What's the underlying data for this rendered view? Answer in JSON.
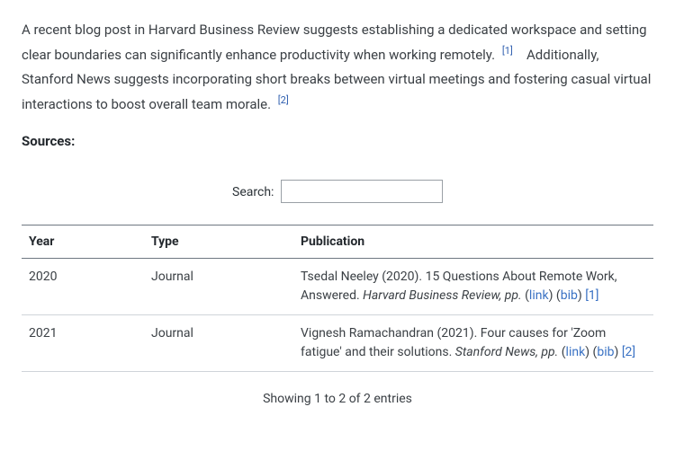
{
  "paragraph": {
    "seg1": "A recent blog post in Harvard Business Review suggests establishing a dedicated workspace and setting clear boundaries can significantly enhance productivity when working remotely.",
    "cite1": "[1]",
    "seg2": "Additionally, Stanford News suggests incorporating short breaks between virtual meetings and fostering casual virtual interactions to boost overall team morale.",
    "cite2": "[2]"
  },
  "sources_heading": "Sources:",
  "search": {
    "label": "Search:",
    "value": ""
  },
  "table": {
    "headers": {
      "year": "Year",
      "type": "Type",
      "publication": "Publication"
    },
    "rows": [
      {
        "year": "2020",
        "type": "Journal",
        "pub_prefix": "Tsedal Neeley (2020). 15 Questions About Remote Work, Answered. ",
        "pub_italic": "Harvard Business Review, pp.",
        "link_label": "link",
        "bib_label": "bib",
        "cite": "[1]"
      },
      {
        "year": "2021",
        "type": "Journal",
        "pub_prefix": "Vignesh Ramachandran (2021). Four causes for 'Zoom fatigue' and their solutions. ",
        "pub_italic": "Stanford News, pp.",
        "link_label": "link",
        "bib_label": "bib",
        "cite": "[2]"
      }
    ]
  },
  "entries_info": "Showing 1 to 2 of 2 entries"
}
